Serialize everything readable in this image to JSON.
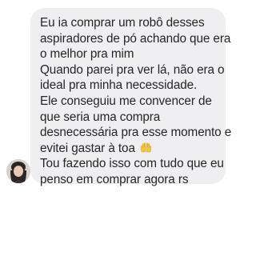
{
  "message": {
    "lines": [
      "Eu ia comprar um robô desses",
      "aspiradores de pó achando que era",
      "o melhor pra mim",
      "Quando parei pra ver lá, não era o",
      "ideal pra minha necessidade.",
      "Ele conseguiu me convencer de",
      "que seria uma compra",
      "desnecessária pra esse momento e",
      "evitei gastar à toa",
      "Tou fazendo isso com tudo que eu",
      "penso em comprar agora rs"
    ],
    "emoji_icon": "raising-hands-icon",
    "bubble_color": "#efeff1",
    "text_color": "#262626"
  },
  "sender": {
    "avatar_icon": "avatar-photo"
  }
}
